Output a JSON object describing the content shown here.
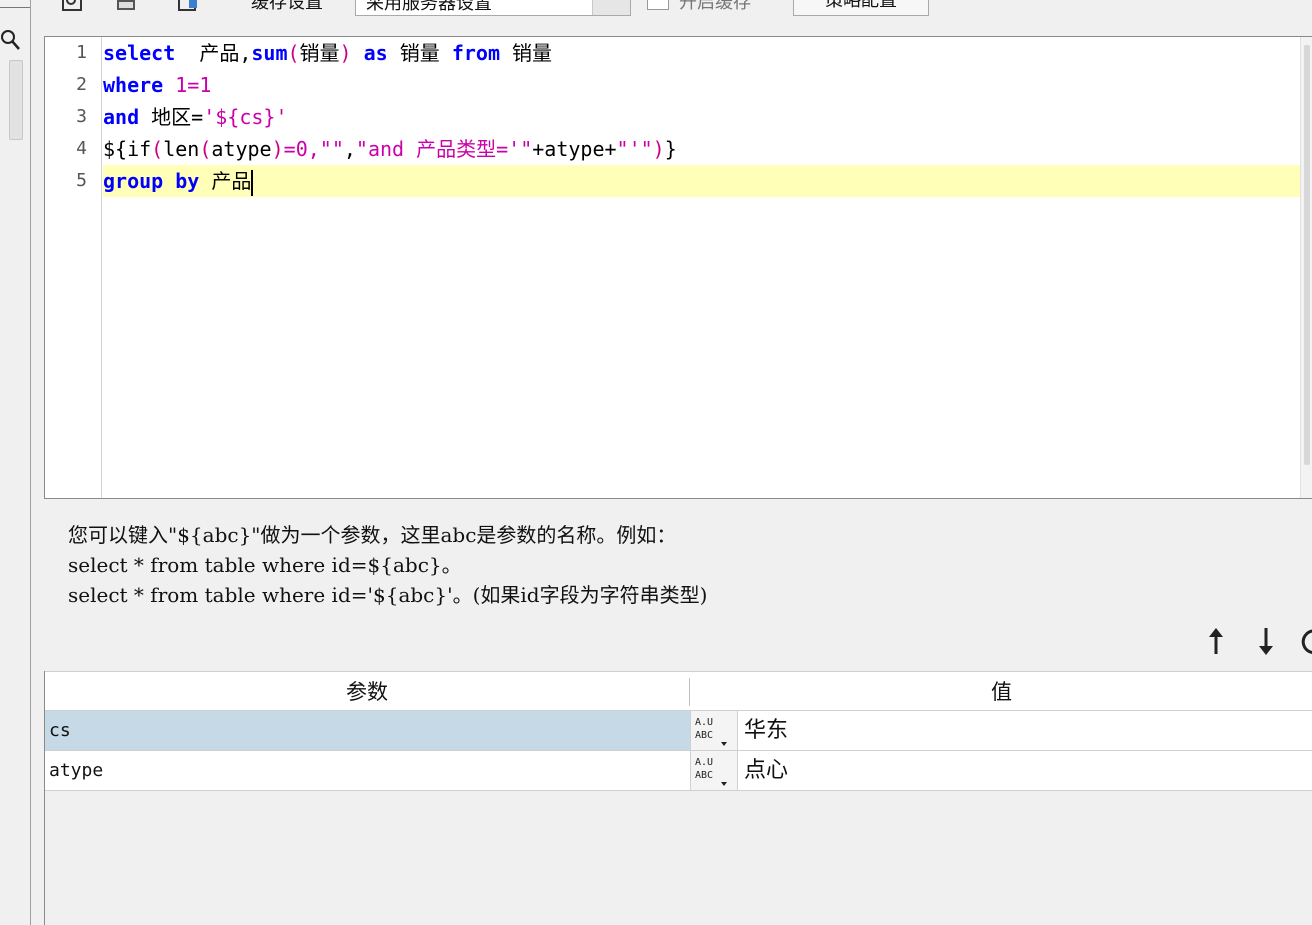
{
  "toolbar": {
    "cache_label": "缓存设置",
    "server_select_value": "采用服务器设置",
    "enable_cache_label": "开启缓存",
    "strategy_button": "策略配置"
  },
  "editor": {
    "line_numbers": [
      "1",
      "2",
      "3",
      "4",
      "5"
    ],
    "lines": {
      "l1": {
        "kw1": "select",
        "t1": "  产品,",
        "fn": "sum",
        "p1": "(",
        "t2": "销量",
        "p2": ")",
        "kw2": "as",
        "t3": " 销量 ",
        "kw3": "from",
        "t4": " 销量"
      },
      "l2": {
        "kw1": "where",
        "num": " 1=1"
      },
      "l3": {
        "kw1": "and",
        "t1": " 地区=",
        "str": "'${cs}'"
      },
      "l4": {
        "t1": "${if",
        "p1": "(",
        "t2": "len",
        "p3": "(",
        "t3": "atype",
        "p4": ")",
        "num": "=0,",
        "str1": "\"\"",
        "t4": ",",
        "str2": "\"and 产品类型='\"",
        "t5": "+atype+",
        "str3": "\"'\"",
        "p2": ")",
        "t6": "}"
      },
      "l5": {
        "kw1": "group",
        "kw2": "by",
        "t1": " 产品"
      }
    }
  },
  "hint": {
    "line1": "您可以键入\"${abc}\"做为一个参数，这里abc是参数的名称。例如：",
    "line2": "select * from table where id=${abc}。",
    "line3": "select * from table where id='${abc}'。(如果id字段为字符串类型)"
  },
  "params": {
    "headers": {
      "name": "参数",
      "value": "值"
    },
    "rows": [
      {
        "name": "cs",
        "value": "华东"
      },
      {
        "name": "atype",
        "value": "点心"
      }
    ]
  },
  "icons": {
    "move_up": "arrow-up-icon",
    "move_down": "arrow-down-icon",
    "refresh": "refresh-icon",
    "type": "abc-type-icon"
  }
}
